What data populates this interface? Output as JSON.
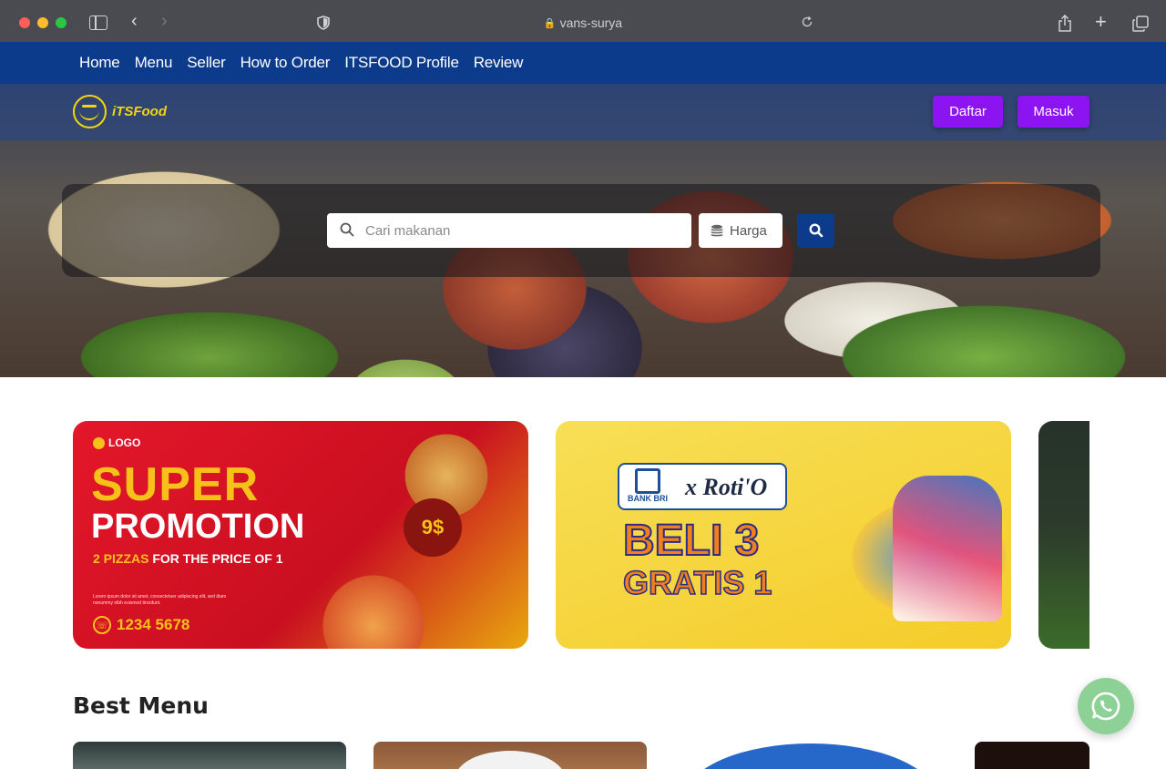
{
  "browser": {
    "url": "vans-surya"
  },
  "navbar": {
    "links": [
      "Home",
      "Menu",
      "Seller",
      "How to Order",
      "ITSFOOD Profile",
      "Review"
    ]
  },
  "header": {
    "brand": "iTSFood",
    "register_label": "Daftar",
    "login_label": "Masuk"
  },
  "search": {
    "placeholder": "Cari makanan",
    "price_label": "Harga"
  },
  "promos": [
    {
      "logo": "LOGO",
      "headline_1": "SUPER",
      "headline_2": "PROMOTION",
      "sub_highlight": "2 PIZZAS",
      "sub_rest": " FOR THE PRICE OF 1",
      "fine_print": "Lorem ipsum dolor sit amet, consectetuer adipiscing elit, sed diam nonummy nibh euismod tincidunt.",
      "phone": "1234 5678",
      "price_badge": "9$"
    },
    {
      "bank": "BANK BRI",
      "partner": "x Roti'O",
      "headline_1": "BELI 3",
      "headline_2": "GRATIS 1"
    }
  ],
  "best_menu": {
    "title": "Best Menu"
  },
  "colors": {
    "navbar": "#0c3b8c",
    "accent_button": "#8b14f0",
    "brand_yellow": "#f5d50f",
    "whatsapp": "#8ed196"
  }
}
